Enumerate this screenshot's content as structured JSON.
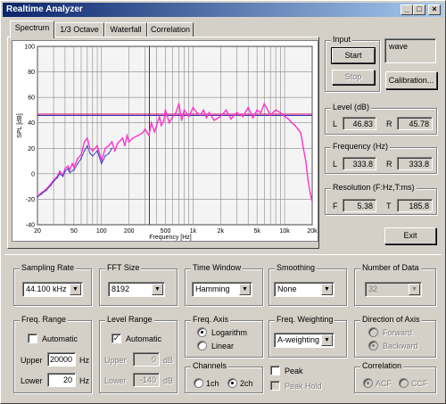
{
  "window": {
    "title": "Realtime Analyzer"
  },
  "titlebar_buttons": {
    "minimize": "_",
    "maximize": "□",
    "close": "×"
  },
  "tabs": [
    {
      "label": "Spectrum"
    },
    {
      "label": "1/3 Octave"
    },
    {
      "label": "Waterfall"
    },
    {
      "label": "Correlation"
    }
  ],
  "chart_data": {
    "type": "line",
    "xlabel": "Frequency [Hz]",
    "ylabel": "SPL [dB]",
    "xscale": "log",
    "xlim": [
      20,
      20000
    ],
    "ylim": [
      -40,
      100
    ],
    "x_ticks": [
      "20",
      "50",
      "100",
      "200",
      "500",
      "1k",
      "2k",
      "5k",
      "10k",
      "20k"
    ],
    "y_ticks": [
      "100",
      "80",
      "60",
      "40",
      "20",
      "0",
      "-20",
      "-40"
    ],
    "grid": true,
    "series": [
      {
        "color": "#ff33cc",
        "x": [
          20,
          22,
          25,
          28,
          30,
          33,
          35,
          38,
          40,
          43,
          45,
          48,
          50,
          55,
          60,
          65,
          70,
          75,
          80,
          90,
          100,
          110,
          120,
          130,
          140,
          150,
          160,
          170,
          180,
          190,
          200,
          220,
          250,
          280,
          300,
          330,
          350,
          380,
          400,
          430,
          450,
          480,
          500,
          550,
          600,
          650,
          700,
          750,
          800,
          900,
          1000,
          1100,
          1200,
          1300,
          1400,
          1500,
          1700,
          2000,
          2300,
          2600,
          3000,
          3500,
          4000,
          4500,
          5000,
          5500,
          6000,
          7000,
          8000,
          9000,
          10000,
          11000,
          12000,
          13000,
          14000,
          15000,
          16000,
          17000,
          18000,
          19000,
          20000
        ],
        "values": [
          -18,
          -15,
          -12,
          -8,
          -5,
          -2,
          2,
          -1,
          4,
          6,
          3,
          8,
          5,
          12,
          15,
          25,
          28,
          20,
          18,
          22,
          10,
          20,
          22,
          25,
          18,
          24,
          26,
          28,
          22,
          30,
          25,
          28,
          30,
          32,
          35,
          30,
          40,
          33,
          38,
          45,
          38,
          42,
          50,
          40,
          45,
          48,
          55,
          42,
          50,
          45,
          52,
          48,
          46,
          50,
          44,
          48,
          42,
          45,
          50,
          43,
          48,
          45,
          52,
          44,
          50,
          48,
          55,
          46,
          50,
          48,
          45,
          43,
          40,
          38,
          35,
          32,
          20,
          10,
          -5,
          -15,
          -22
        ]
      },
      {
        "color": "#4040c0",
        "x": [
          20,
          22,
          25,
          28,
          30,
          33,
          35,
          38,
          40,
          43,
          45,
          50,
          55,
          60,
          65,
          70,
          75,
          80,
          90,
          100,
          110,
          120,
          130
        ],
        "values": [
          -18,
          -16,
          -13,
          -9,
          -6,
          -3,
          0,
          -2,
          2,
          4,
          1,
          3,
          8,
          12,
          18,
          22,
          16,
          14,
          18,
          8,
          14,
          16,
          20
        ]
      }
    ],
    "horizontal_lines": [
      {
        "value": 46.83,
        "color": "#cc0066"
      },
      {
        "value": 45.78,
        "color": "#3333aa"
      }
    ],
    "vertical_marker": {
      "value": 333.8,
      "color": "#cc0000"
    }
  },
  "input": {
    "label": "Input",
    "start": "Start",
    "stop": "Stop",
    "source": "wave",
    "calibration": "Calibration..."
  },
  "level": {
    "label": "Level (dB)",
    "L_label": "L",
    "L": "46.83",
    "R_label": "R",
    "R": "45.78"
  },
  "frequency": {
    "label": "Frequency (Hz)",
    "L_label": "L",
    "L": "333.8",
    "R_label": "R",
    "R": "333.8"
  },
  "resolution": {
    "label": "Resolution (F:Hz,T:ms)",
    "F_label": "F",
    "F": "5.38",
    "T_label": "T",
    "T": "185.8"
  },
  "exit": "Exit",
  "sampling_rate": {
    "label": "Sampling Rate",
    "value": "44.100 kHz"
  },
  "fft_size": {
    "label": "FFT Size",
    "value": "8192"
  },
  "time_window": {
    "label": "Time Window",
    "value": "Hamming"
  },
  "smoothing": {
    "label": "Smoothing",
    "value": "None"
  },
  "number_of_data": {
    "label": "Number of Data",
    "value": "32"
  },
  "freq_range": {
    "label": "Freq. Range",
    "automatic": "Automatic",
    "upper_label": "Upper",
    "upper": "20000",
    "lower_label": "Lower",
    "lower": "20",
    "unit": "Hz"
  },
  "level_range": {
    "label": "Level Range",
    "automatic": "Automatic",
    "upper_label": "Upper",
    "upper": "0",
    "lower_label": "Lower",
    "lower": "-140",
    "unit": "dB"
  },
  "freq_axis": {
    "label": "Freq. Axis",
    "log": "Logarithm",
    "linear": "Linear"
  },
  "freq_weighting": {
    "label": "Freq. Weighting",
    "value": "A-weighting"
  },
  "direction": {
    "label": "Direction of Axis",
    "forward": "Forward",
    "backward": "Backward"
  },
  "channels": {
    "label": "Channels",
    "ch1": "1ch",
    "ch2": "2ch"
  },
  "peak": {
    "peak": "Peak",
    "peak_hold": "Peak Hold"
  },
  "correlation": {
    "label": "Correlation",
    "acf": "ACF",
    "ccf": "CCF"
  }
}
